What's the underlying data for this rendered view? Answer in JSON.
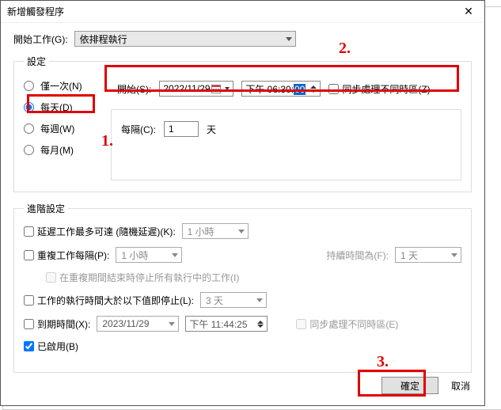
{
  "window_title": "新增觸發程序",
  "begin_work_label": "開始工作(G):",
  "begin_work_value": "依排程執行",
  "settings_legend": "設定",
  "radios": {
    "once": "僅一次(N)",
    "daily": "每天(D)",
    "weekly": "每週(W)",
    "monthly": "每月(M)"
  },
  "start_label": "開始(S):",
  "start_date": "2022/11/29",
  "start_time_prefix": "下午 06:30:",
  "start_time_sel": "00",
  "sync_tz_label": "同步處理不同時區(Z)",
  "interval_label": "每隔(C):",
  "interval_value": "1",
  "interval_unit": "天",
  "advanced_legend": "進階設定",
  "delay_label": "延遲工作最多可達 (隨機延遲)(K):",
  "delay_value": "1 小時",
  "repeat_label": "重複工作每隔(P):",
  "repeat_value": "1 小時",
  "duration_label": "持續時間為(F):",
  "duration_value": "1 天",
  "stop_on_end_label": "在重複期間結束時停止所有執行中的工作(I)",
  "stop_if_label": "工作的執行時間大於以下值即停止(L):",
  "stop_if_value": "3 天",
  "expire_label": "到期時間(X):",
  "expire_date": "2023/11/29",
  "expire_time": "下午 11:44:25",
  "expire_sync_label": "同步處理不同時區(E)",
  "enabled_label": "已啟用(B)",
  "ok_label": "確定",
  "cancel_label": "取消",
  "ann": {
    "n1": "1.",
    "n2": "2.",
    "n3": "3."
  }
}
